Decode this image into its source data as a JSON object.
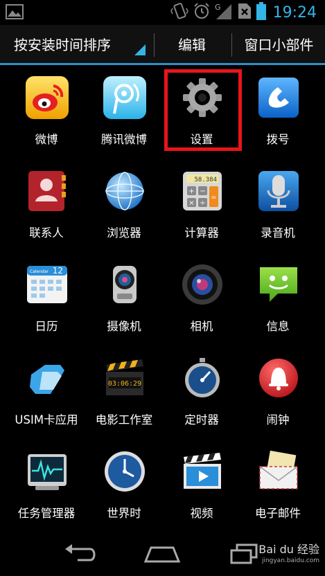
{
  "status_bar": {
    "time": "19:24",
    "accent": "#33b5e5",
    "icons": [
      "gallery-notification-icon",
      "vibrate-icon",
      "alarm-icon",
      "signal-icon",
      "no-sim-icon",
      "battery-icon"
    ]
  },
  "header": {
    "tabs": [
      {
        "label": "按安装时间排序"
      },
      {
        "label": "编辑"
      },
      {
        "label": "窗口小部件"
      }
    ]
  },
  "apps": [
    {
      "label": "微博",
      "icon": "weibo-icon"
    },
    {
      "label": "腾讯微博",
      "icon": "tencent-weibo-icon"
    },
    {
      "label": "设置",
      "icon": "settings-gear-icon",
      "highlighted": true
    },
    {
      "label": "拨号",
      "icon": "phone-dialer-icon"
    },
    {
      "label": "联系人",
      "icon": "contacts-icon"
    },
    {
      "label": "浏览器",
      "icon": "browser-globe-icon"
    },
    {
      "label": "计算器",
      "icon": "calculator-icon",
      "display": "58.384"
    },
    {
      "label": "录音机",
      "icon": "microphone-icon"
    },
    {
      "label": "日历",
      "icon": "calendar-icon",
      "day": "12",
      "header": "Calendar"
    },
    {
      "label": "摄像机",
      "icon": "camcorder-icon"
    },
    {
      "label": "相机",
      "icon": "camera-lens-icon"
    },
    {
      "label": "信息",
      "icon": "messaging-icon"
    },
    {
      "label": "USIM卡应用",
      "icon": "sim-card-icon"
    },
    {
      "label": "电影工作室",
      "icon": "movie-studio-icon",
      "display": "03:06:29"
    },
    {
      "label": "定时器",
      "icon": "stopwatch-icon"
    },
    {
      "label": "闹钟",
      "icon": "alarm-bell-icon"
    },
    {
      "label": "任务管理器",
      "icon": "task-manager-icon"
    },
    {
      "label": "世界时",
      "icon": "world-clock-icon"
    },
    {
      "label": "视频",
      "icon": "video-player-icon"
    },
    {
      "label": "电子邮件",
      "icon": "email-icon"
    }
  ],
  "nav": {
    "buttons": [
      "back-icon",
      "home-icon",
      "recent-apps-icon"
    ]
  },
  "watermark": {
    "brand": "Bai du 经验",
    "url": "jingyan.baidu.com"
  },
  "colors": {
    "highlight": "#e8141b",
    "tab_underline": "#2f8fc7"
  }
}
